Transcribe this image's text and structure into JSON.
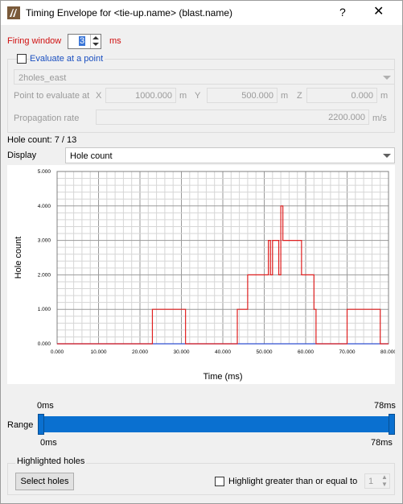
{
  "window": {
    "title": "Timing Envelope for <tie-up.name> (blast.name)",
    "help": "?",
    "close": "✕"
  },
  "firing_window": {
    "label": "Firing window",
    "value": "3",
    "unit": "ms"
  },
  "evaluate": {
    "label": "Evaluate at a point",
    "checked": false
  },
  "point_select": {
    "value": "2holes_east"
  },
  "point": {
    "label": "Point to evaluate at",
    "x_label": "X",
    "x_value": "1000.000",
    "x_unit": "m",
    "y_label": "Y",
    "y_value": "500.000",
    "y_unit": "m",
    "z_label": "Z",
    "z_value": "0.000",
    "z_unit": "m"
  },
  "propagation": {
    "label": "Propagation rate",
    "value": "2200.000",
    "unit": "m/s"
  },
  "hole_count_text": "Hole count: 7 / 13",
  "display": {
    "label": "Display",
    "value": "Hole count"
  },
  "chart_data": {
    "type": "line",
    "xlabel": "Time (ms)",
    "ylabel": "Hole count",
    "xlim": [
      0,
      80
    ],
    "ylim": [
      0,
      5
    ],
    "x_ticks": [
      "0.000",
      "10.000",
      "20.000",
      "30.000",
      "40.000",
      "50.000",
      "60.000",
      "70.000",
      "80.000"
    ],
    "y_ticks": [
      "0.000",
      "1.000",
      "2.000",
      "3.000",
      "4.000",
      "5.000"
    ],
    "grid": true,
    "series": [
      {
        "color": "#e02020",
        "x": [
          0,
          23,
          23,
          31,
          31,
          43.5,
          43.5,
          46,
          46,
          51,
          51,
          51.5,
          51.5,
          52,
          52,
          53.5,
          53.5,
          54,
          54,
          54.5,
          54.5,
          59,
          59,
          62,
          62,
          62.5,
          62.5,
          70,
          70,
          78,
          78,
          80
        ],
        "y": [
          0,
          0,
          1,
          1,
          0,
          0,
          1,
          1,
          2,
          2,
          3,
          3,
          2,
          2,
          3,
          3,
          2,
          2,
          4,
          4,
          3,
          3,
          2,
          2,
          1,
          1,
          0,
          0,
          1,
          1,
          0,
          0
        ]
      }
    ]
  },
  "range": {
    "label": "Range",
    "top_min": "0ms",
    "top_max": "78ms",
    "bottom_min": "0ms",
    "bottom_max": "78ms",
    "low": 0,
    "high": 1
  },
  "highlighted": {
    "title": "Highlighted holes",
    "select_button": "Select holes",
    "greater_label": "Highlight greater than or equal to",
    "greater_checked": false,
    "greater_value": "1"
  }
}
